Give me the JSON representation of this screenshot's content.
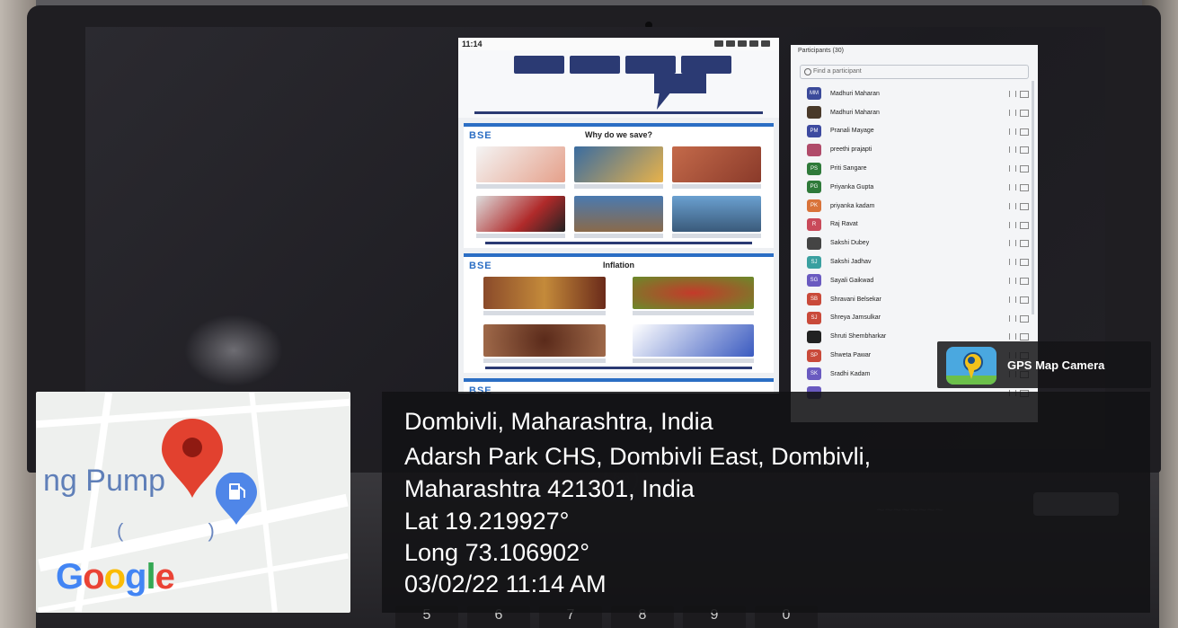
{
  "phone": {
    "time": "11:14",
    "panel1_logo": "BSE",
    "panel1_title": "Why do we save?",
    "panel2_logo": "BSE",
    "panel2_title": "Inflation",
    "panel3_logo": "BSE"
  },
  "participants": {
    "header": "Participants (30)",
    "search_placeholder": "Find a participant",
    "rows": [
      {
        "name": "Madhuri Maharan",
        "initials": "MM",
        "color": "#3b4a9a"
      },
      {
        "name": "Madhuri Maharan",
        "initials": "",
        "color": "#4a3a2a"
      },
      {
        "name": "Pranali Mayage",
        "initials": "PM",
        "color": "#3d4aa0"
      },
      {
        "name": "preethi prajapti",
        "initials": "",
        "color": "#b04b6a"
      },
      {
        "name": "Priti Sangare",
        "initials": "PS",
        "color": "#2f7a3a"
      },
      {
        "name": "Priyanka Gupta",
        "initials": "PG",
        "color": "#2f7a3a"
      },
      {
        "name": "priyanka kadam",
        "initials": "PK",
        "color": "#d9733a"
      },
      {
        "name": "Raj Ravat",
        "initials": "R",
        "color": "#c94a5a"
      },
      {
        "name": "Sakshi Dubey",
        "initials": "",
        "color": "#444"
      },
      {
        "name": "Sakshi Jadhav",
        "initials": "SJ",
        "color": "#3aa0a0"
      },
      {
        "name": "Sayali Gaikwad",
        "initials": "SG",
        "color": "#6a5ac0"
      },
      {
        "name": "Shravani Belsekar",
        "initials": "SB",
        "color": "#c94a3a"
      },
      {
        "name": "Shreya Jamsulkar",
        "initials": "SJ",
        "color": "#c94a3a"
      },
      {
        "name": "Shruti Shembharkar",
        "initials": "",
        "color": "#222"
      },
      {
        "name": "Shweta Pawar",
        "initials": "SP",
        "color": "#c94a3a"
      },
      {
        "name": "Sradhi Kadam",
        "initials": "SK",
        "color": "#6a5ac0"
      },
      {
        "name": "",
        "initials": "",
        "color": "#6a5ac0"
      }
    ]
  },
  "gps": {
    "app_name": "GPS Map Camera",
    "map_place_text": "ng Pump",
    "map_paren": "( )",
    "google_logo": "Google",
    "city": "Dombivli, Maharashtra, India",
    "address_line1": "Adarsh Park CHS, Dombivli East, Dombivli,",
    "address_line2": "Maharashtra 421301, India",
    "lat": "Lat 19.219927°",
    "long": "Long 73.106902°",
    "datetime": "03/02/22 11:14 AM"
  },
  "keyboard": {
    "keys": [
      "5",
      "6",
      "7",
      "8",
      "9",
      "0"
    ]
  },
  "colors": {
    "map_pin": "#e2412f",
    "fuel_pin": "#4f86e8",
    "phone_accent": "#2b3a73"
  }
}
